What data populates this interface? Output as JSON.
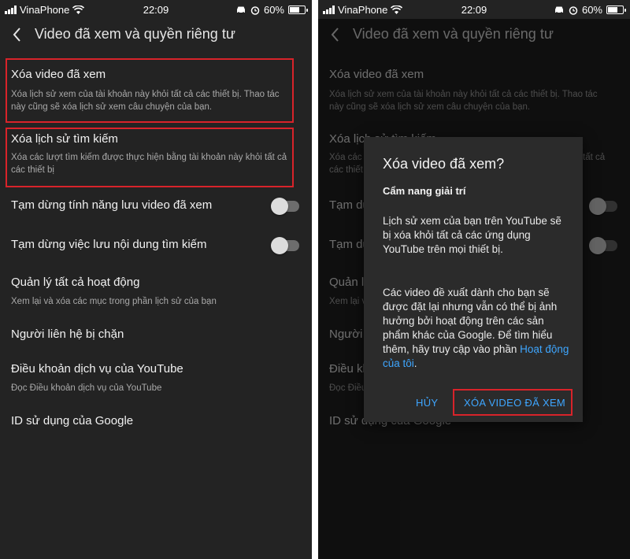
{
  "status_bar": {
    "carrier": "VinaPhone",
    "time": "22:09",
    "battery": "60%",
    "battery_level": 0.6
  },
  "header": {
    "title": "Video đã xem và quyền riêng tư"
  },
  "settings": {
    "clear_watch": {
      "title": "Xóa video đã xem",
      "subtitle": "Xóa lịch sử xem của tài khoản này khỏi tất cả các thiết bị. Thao tác này cũng sẽ xóa lịch sử xem câu chuyện của bạn."
    },
    "clear_search": {
      "title": "Xóa lịch sử tìm kiếm",
      "subtitle": "Xóa các lượt tìm kiếm được thực hiện bằng tài khoản này khỏi tất cả các thiết bị"
    },
    "pause_watch": {
      "title": "Tạm dừng tính năng lưu video đã xem",
      "enabled": false
    },
    "pause_search": {
      "title": "Tạm dừng việc lưu nội dung tìm kiếm",
      "enabled": false
    },
    "manage_activity": {
      "title": "Quản lý tất cả hoạt động",
      "subtitle": "Xem lại và xóa các mục trong phần lịch sử của bạn"
    },
    "blocked_contacts": {
      "title": "Người liên hệ bị chặn"
    },
    "terms": {
      "title": "Điều khoản dịch vụ của YouTube",
      "subtitle": "Đọc Điều khoản dịch vụ của YouTube"
    },
    "google_id": {
      "title": "ID sử dụng của Google"
    }
  },
  "dialog": {
    "title": "Xóa video đã xem?",
    "account": "Cẩm nang giải trí",
    "para1": "Lịch sử xem của bạn trên YouTube sẽ bị xóa khỏi tất cả các ứng dụng YouTube trên mọi thiết bị.",
    "para2_text": "Các video đề xuất dành cho bạn sẽ được đặt lại nhưng vẫn có thể bị ảnh hưởng bởi hoạt động trên các sản phẩm khác của Google. Để tìm hiểu thêm, hãy truy cập vào phần ",
    "para2_link": "Hoạt động của tôi",
    "para2_end": ".",
    "cancel_label": "HỦY",
    "confirm_label": "XÓA VIDEO ĐÃ XEM"
  },
  "colors": {
    "background": "#232323",
    "highlight": "#d8232a",
    "link": "#3ea6ff"
  }
}
